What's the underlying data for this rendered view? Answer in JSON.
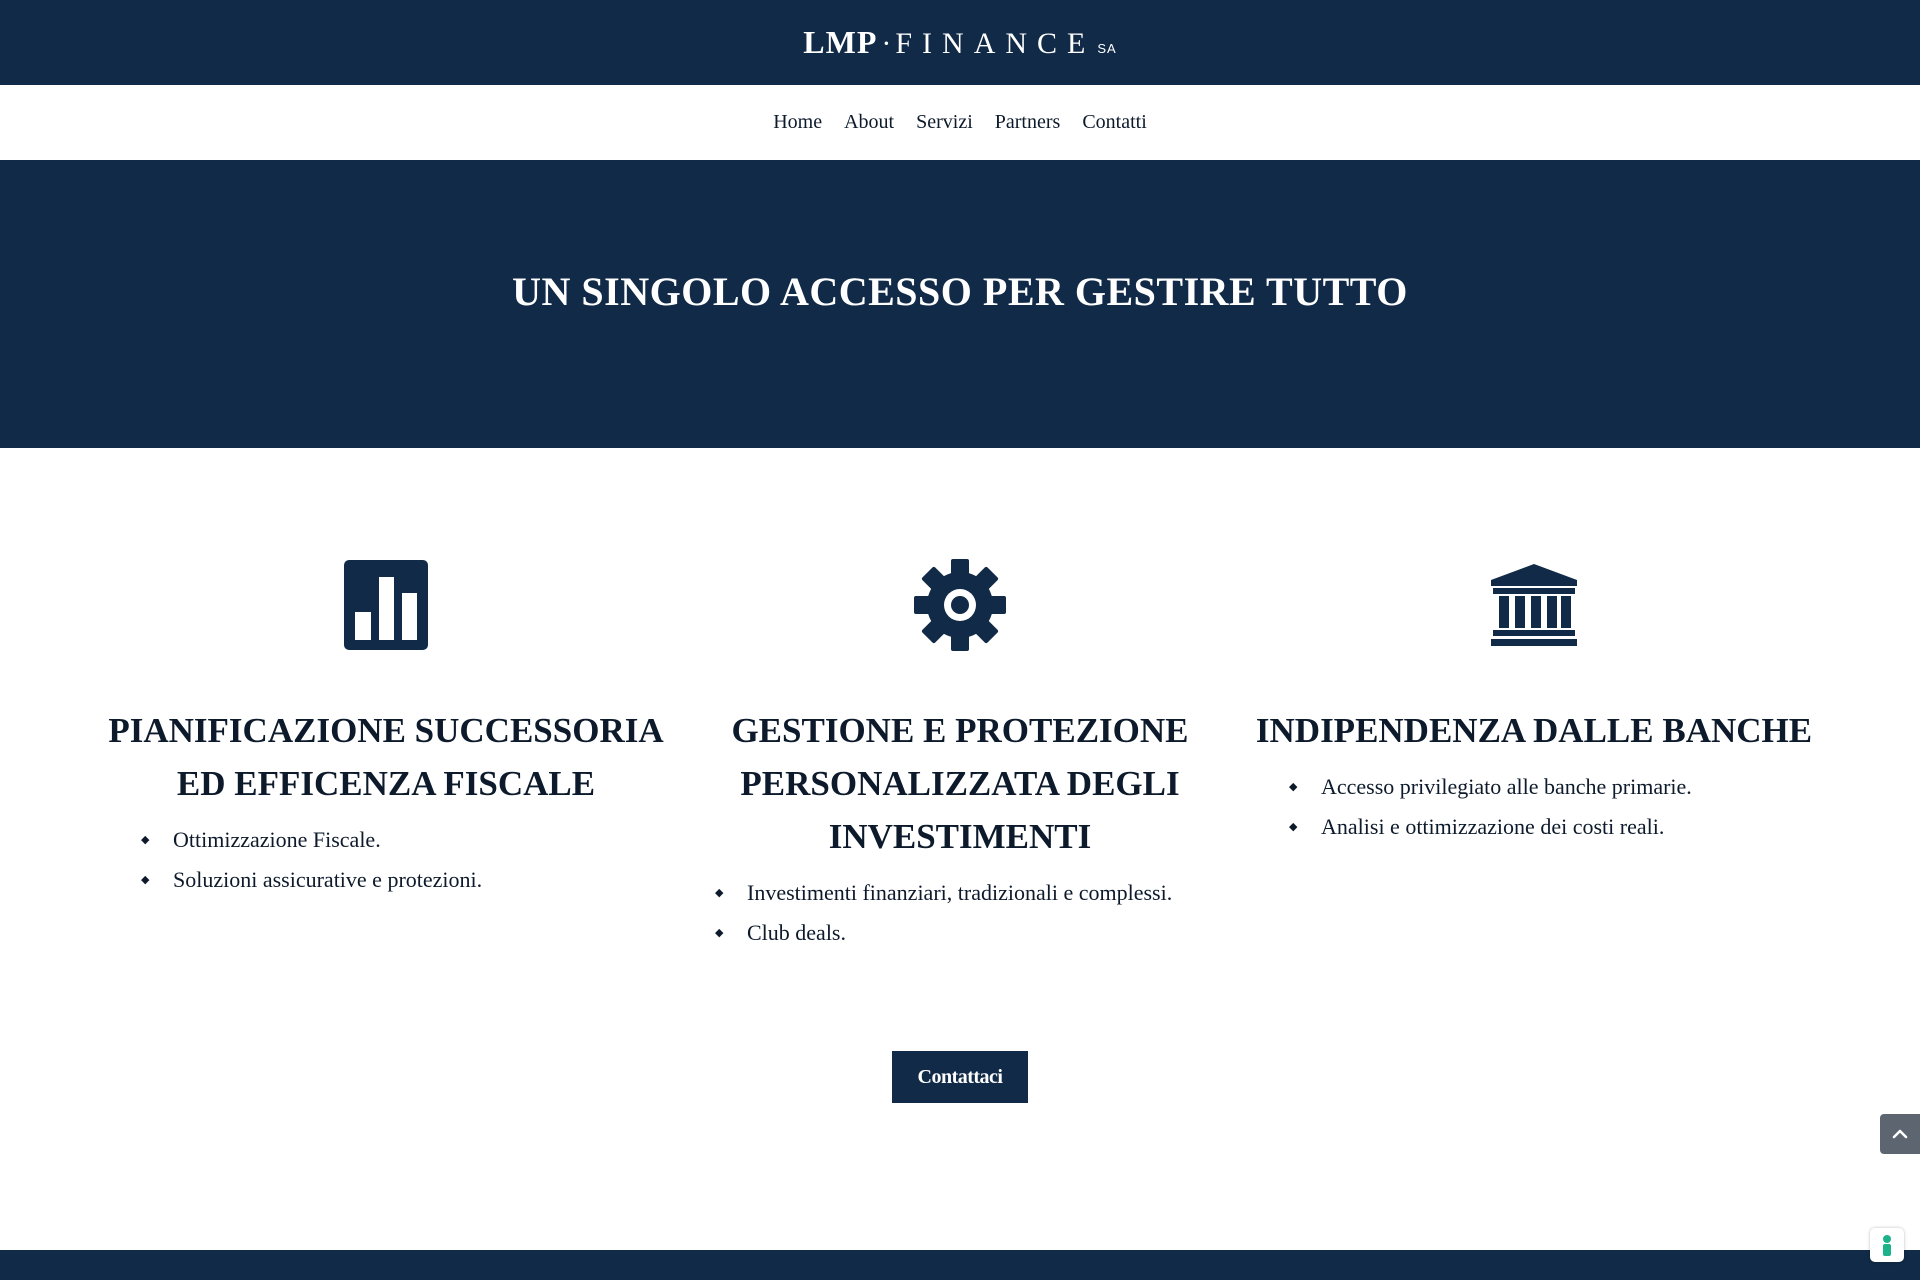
{
  "brand": {
    "name_main": "LMP",
    "name_sep": "·",
    "name_finance": "FINANCE",
    "name_suffix": "SA"
  },
  "nav": [
    {
      "label": "Home"
    },
    {
      "label": "About"
    },
    {
      "label": "Servizi"
    },
    {
      "label": "Partners"
    },
    {
      "label": "Contatti"
    }
  ],
  "hero": {
    "title": "UN SINGOLO ACCESSO PER GESTIRE TUTTO"
  },
  "features": [
    {
      "icon": "bar-chart-icon",
      "title": "PIANIFICAZIONE SUCCESSORIA ED EFFICENZA FISCALE",
      "items": [
        "Ottimizzazione Fiscale.",
        "Soluzioni assicurative e protezioni."
      ]
    },
    {
      "icon": "gear-icon",
      "title": "GESTIONE E PROTEZIONE PERSONALIZZATA DEGLI INVESTIMENTI",
      "items": [
        "Investimenti finanziari, tradizionali e complessi.",
        "Club deals."
      ]
    },
    {
      "icon": "bank-icon",
      "title": "INDIPENDENZA DALLE BANCHE",
      "items": [
        "Accesso privilegiato alle banche primarie.",
        "Analisi e ottimizzazione dei costi reali."
      ]
    }
  ],
  "cta": {
    "label": "Contattaci"
  },
  "colors": {
    "primary": "#102a47",
    "text": "#0d1a2b",
    "scroll_button": "#5d6670",
    "badge_accent": "#1db38a"
  }
}
